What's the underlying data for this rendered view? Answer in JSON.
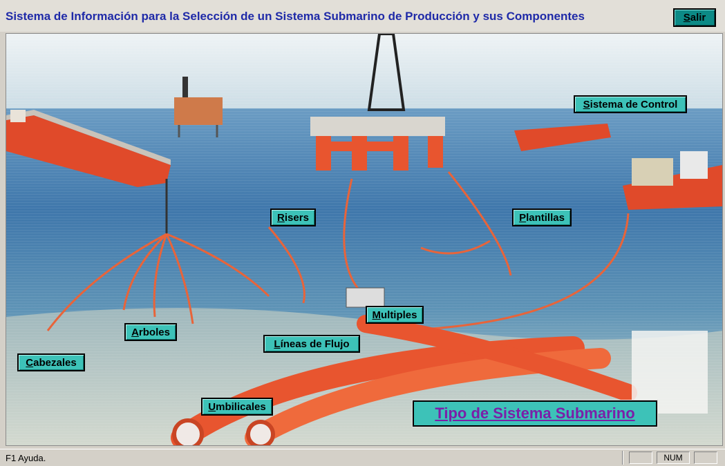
{
  "window": {
    "title": "Sistema de Información para la Selección de un Sistema Submarino de Producción y sus Componentes",
    "exit_button": {
      "accel": "S",
      "rest": "alir"
    }
  },
  "scene": {
    "buttons": {
      "sistema_control": {
        "accel": "S",
        "rest": "istema de Control"
      },
      "risers": {
        "accel": "R",
        "rest": "isers"
      },
      "plantillas": {
        "accel": "P",
        "rest": "lantillas"
      },
      "arboles": {
        "accel": "A",
        "rest": "rboles"
      },
      "multiples": {
        "accel": "M",
        "rest": "ultiples"
      },
      "lineas_flujo": {
        "accel": "L",
        "rest": "íneas de Flujo"
      },
      "cabezales": {
        "accel": "C",
        "rest": "abezales"
      },
      "umbilicales": {
        "accel": "U",
        "rest": "mbilicales"
      },
      "tipo_sistema": "Tipo de Sistema Submarino"
    },
    "colors": {
      "sky": "#dfe9ef",
      "sea": "#4e86b4",
      "deep": "#2f5d93",
      "seabed": "#b7c4c4",
      "pipe": "#e8643a",
      "button": "#3dc2b8",
      "title": "#1f2aa8",
      "accent_text": "#7b1fa8"
    }
  },
  "statusbar": {
    "help": "F1  Ayuda.",
    "panel2": "NUM"
  }
}
